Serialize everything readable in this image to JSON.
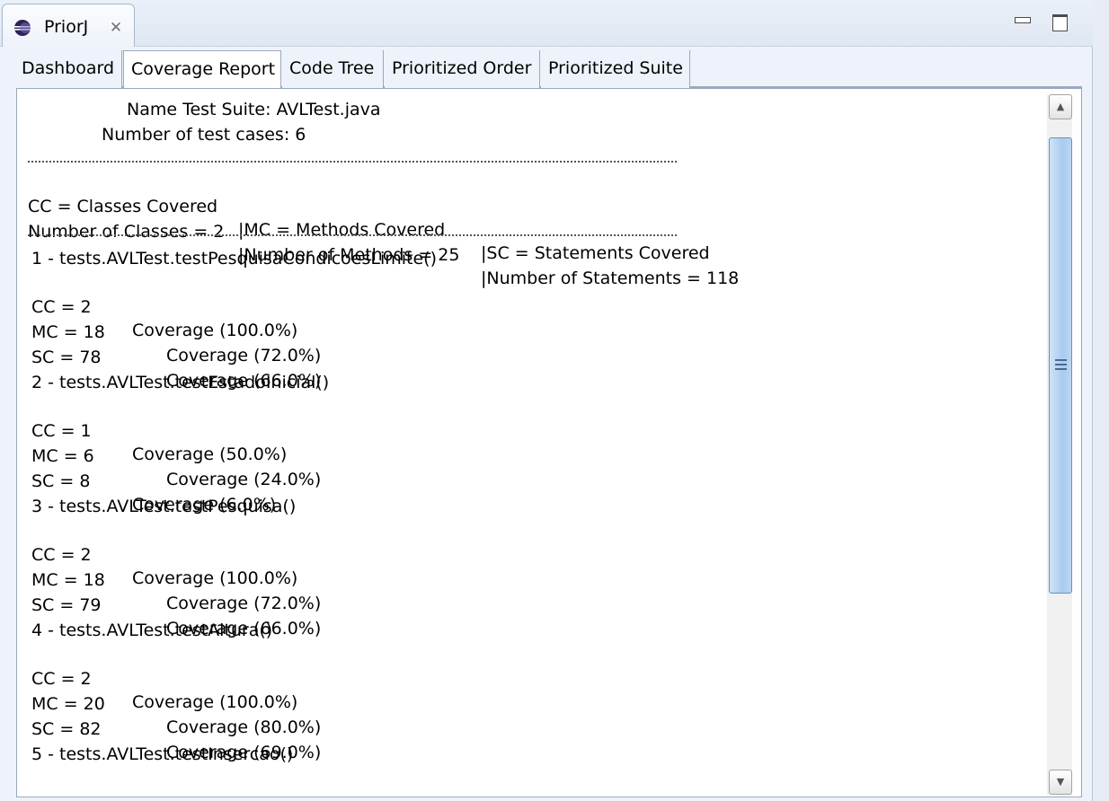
{
  "view": {
    "title": "PriorJ",
    "icon": "eclipse-sphere-icon",
    "close_glyph": "✕"
  },
  "tabs": [
    {
      "label": "Dashboard",
      "active": false
    },
    {
      "label": "Coverage Report",
      "active": true
    },
    {
      "label": "Code Tree",
      "active": false
    },
    {
      "label": "Prioritized Order",
      "active": false
    },
    {
      "label": "Prioritized Suite",
      "active": false
    }
  ],
  "report": {
    "suite_name": "Name Test Suite: AVLTest.java",
    "test_case_count": "Number of test cases: 6",
    "legend": {
      "cc": "CC = Classes Covered",
      "mc": "|MC = Methods Covered",
      "sc": "|SC = Statements Covered"
    },
    "totals": {
      "classes": "Number of Classes = 2",
      "methods": "|Number of Methods = 25",
      "statements": "|Number of Statements = 118"
    },
    "tests": [
      {
        "title": "1 - tests.AVLTest.testPesquisaCondicoesLimite()",
        "cc": {
          "label": "CC = 2",
          "coverage": "Coverage (100.0%)"
        },
        "mc": {
          "label": "MC = 18",
          "coverage": "Coverage (72.0%)"
        },
        "sc": {
          "label": "SC = 78",
          "coverage": "Coverage (66.0%)"
        }
      },
      {
        "title": "2 - tests.AVLTest.testEstadoInicial()",
        "cc": {
          "label": "CC = 1",
          "coverage": "Coverage (50.0%)"
        },
        "mc": {
          "label": "MC = 6",
          "coverage": "Coverage (24.0%)"
        },
        "sc": {
          "label": "SC = 8",
          "coverage": "Coverage (6.0%)"
        }
      },
      {
        "title": "3 - tests.AVLTest.testPesquisa()",
        "cc": {
          "label": "CC = 2",
          "coverage": "Coverage (100.0%)"
        },
        "mc": {
          "label": "MC = 18",
          "coverage": "Coverage (72.0%)"
        },
        "sc": {
          "label": "SC = 79",
          "coverage": "Coverage (66.0%)"
        }
      },
      {
        "title": "4 - tests.AVLTest.testAltura()",
        "cc": {
          "label": "CC = 2",
          "coverage": "Coverage (100.0%)"
        },
        "mc": {
          "label": "MC = 20",
          "coverage": "Coverage (80.0%)"
        },
        "sc": {
          "label": "SC = 82",
          "coverage": "Coverage (69.0%)"
        }
      },
      {
        "title": "5 - tests.AVLTest.testInsercao()"
      }
    ]
  },
  "scrollbar": {
    "up_glyph": "▲",
    "down_glyph": "▼"
  }
}
